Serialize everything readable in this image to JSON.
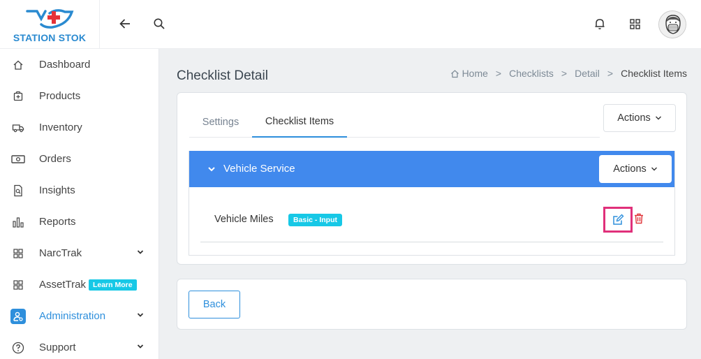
{
  "brand": {
    "name": "STATION STOK",
    "accent": "#2e8fdc",
    "cross_color": "#e53238"
  },
  "sidebar": {
    "items": [
      {
        "label": "Dashboard",
        "icon": "home-icon"
      },
      {
        "label": "Products",
        "icon": "box-plus-icon"
      },
      {
        "label": "Inventory",
        "icon": "truck-icon"
      },
      {
        "label": "Orders",
        "icon": "cash-icon"
      },
      {
        "label": "Insights",
        "icon": "search-document-icon"
      },
      {
        "label": "Reports",
        "icon": "bar-chart-icon"
      },
      {
        "label": "NarcTrak",
        "icon": "grid-icon",
        "expandable": true
      },
      {
        "label": "AssetTrak",
        "icon": "grid-icon",
        "badge": "Learn More"
      },
      {
        "label": "Administration",
        "icon": "admin-user-icon",
        "active": true,
        "expandable": true
      },
      {
        "label": "Support",
        "icon": "help-circle-icon",
        "expandable": true
      }
    ]
  },
  "topbar": {
    "back_icon": "arrow-left-icon",
    "search_icon": "search-icon",
    "bell_icon": "bell-icon",
    "apps_icon": "apps-grid-icon",
    "avatar": "avatar"
  },
  "page": {
    "title": "Checklist Detail",
    "breadcrumb": [
      "Home",
      "Checklists",
      "Detail",
      "Checklist Items"
    ]
  },
  "tabs": [
    {
      "label": "Settings",
      "active": false
    },
    {
      "label": "Checklist Items",
      "active": true
    }
  ],
  "actions_label": "Actions",
  "section": {
    "title": "Vehicle Service",
    "section_color": "#4189ed",
    "actions_label": "Actions",
    "items": [
      {
        "label": "Vehicle Miles",
        "type_badge": "Basic - Input"
      }
    ]
  },
  "back_button": "Back",
  "highlight_color": "#e0307a"
}
